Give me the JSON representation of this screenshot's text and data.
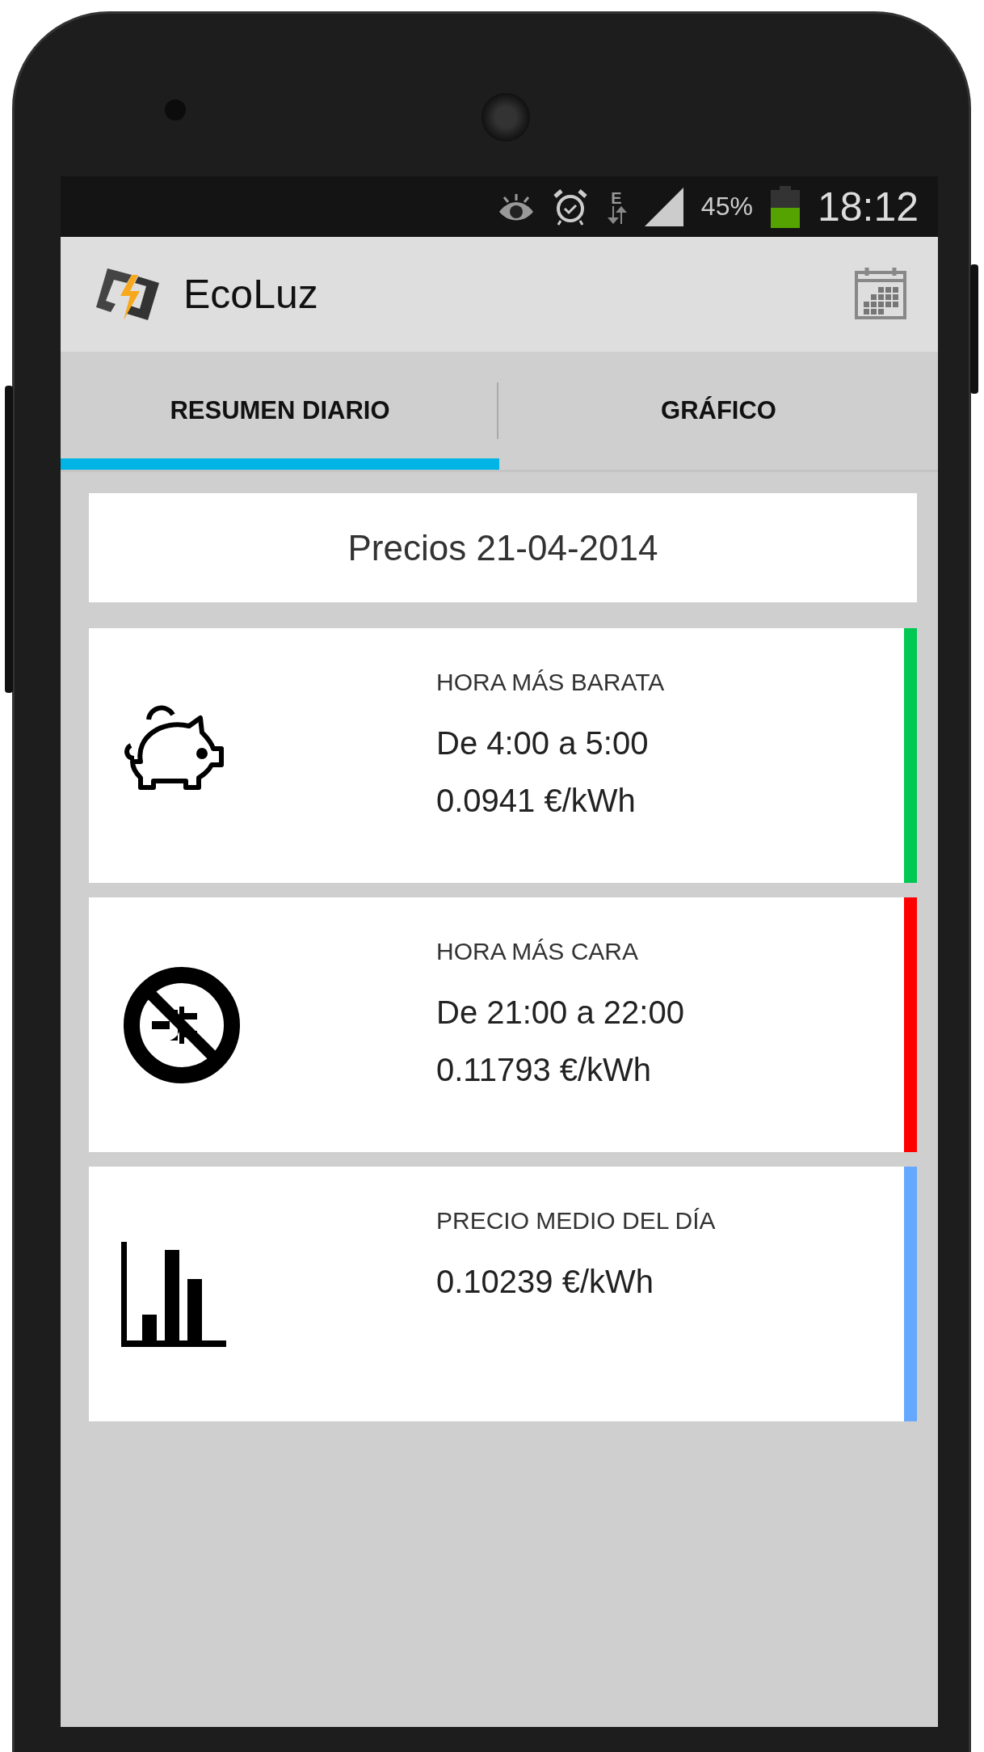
{
  "status_bar": {
    "network": "E",
    "battery": "45%",
    "time": "18:12"
  },
  "app_bar": {
    "title": "EcoLuz"
  },
  "tabs": [
    {
      "label": "RESUMEN DIARIO",
      "selected": true
    },
    {
      "label": "GRÁFICO",
      "selected": false
    }
  ],
  "date_header": "Precios 21-04-2014",
  "cards": [
    {
      "kind": "piggy",
      "label": "HORA MÁS BARATA",
      "lines": [
        "De 4:00 a 5:00",
        "0.0941 €/kWh"
      ],
      "color": "#00c853"
    },
    {
      "kind": "noplug",
      "label": "HORA MÁS CARA",
      "lines": [
        "De 21:00 a 22:00",
        "0.11793 €/kWh"
      ],
      "color": "#ff0000"
    },
    {
      "kind": "bars",
      "label": "PRECIO MEDIO DEL DÍA",
      "lines": [
        "0.10239 €/kWh"
      ],
      "color": "#64a8ff"
    }
  ]
}
